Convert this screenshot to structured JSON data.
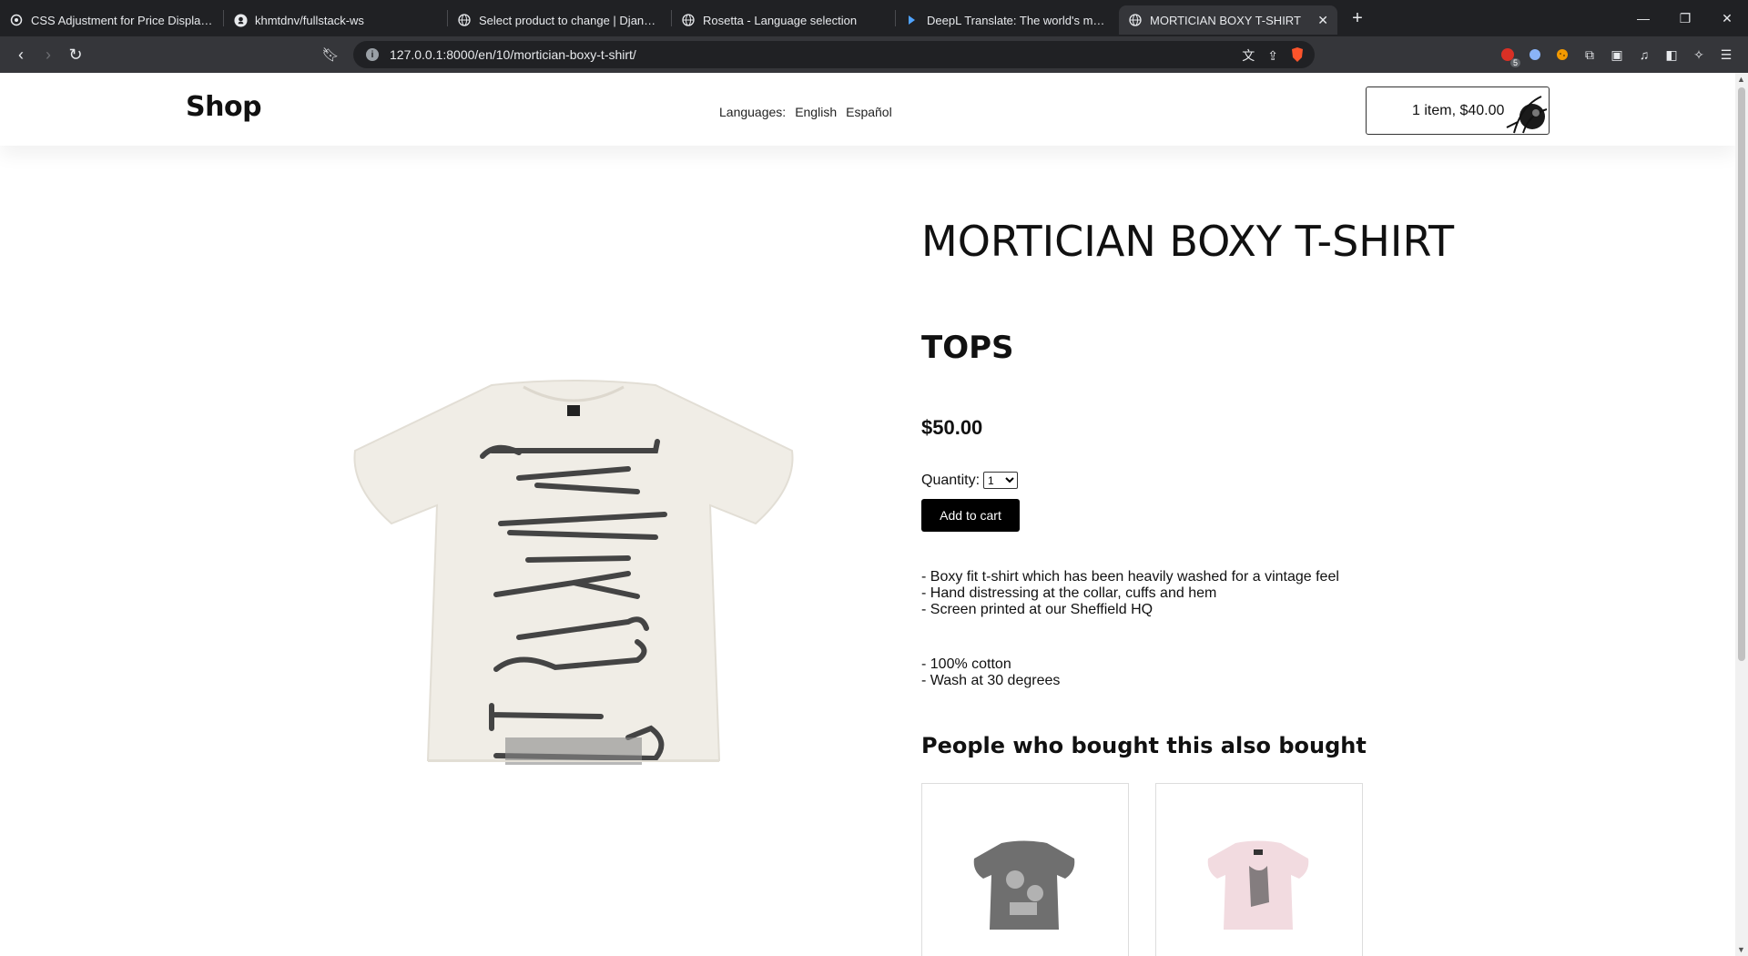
{
  "browser": {
    "tabs": [
      {
        "title": "CSS Adjustment for Price Display - G",
        "icon": "chatgpt-icon"
      },
      {
        "title": "khmtdnv/fullstack-ws",
        "icon": "github-icon"
      },
      {
        "title": "Select product to change | Django sit",
        "icon": "globe-icon"
      },
      {
        "title": "Rosetta - Language selection",
        "icon": "globe-icon"
      },
      {
        "title": "DeepL Translate: The world's most ac",
        "icon": "deepl-icon"
      },
      {
        "title": "MORTICIAN BOXY T-SHIRT",
        "icon": "globe-icon",
        "active": true
      }
    ],
    "url": "127.0.0.1:8000/en/10/mortician-boxy-t-shirt/",
    "extension_badge": "5"
  },
  "header": {
    "logo": "Shop",
    "languages_label": "Languages:",
    "languages": [
      "English",
      "Español"
    ],
    "cart_summary": "1 item, $40.00"
  },
  "product": {
    "title": "MORTICIAN BOXY T-SHIRT",
    "category": "TOPS",
    "price": "$50.00",
    "quantity_label": "Quantity:",
    "quantity_value": "1",
    "add_to_cart": "Add to cart",
    "description": [
      "- Boxy fit t-shirt which has been heavily washed for a vintage feel",
      "- Hand distressing at the collar, cuffs and hem",
      "- Screen printed at our Sheffield HQ"
    ],
    "details": [
      "- 100% cotton",
      "- Wash at 30 degrees"
    ]
  },
  "recommendations": {
    "heading": "People who bought this also bought",
    "items": [
      {
        "color": "#6f6f6f"
      },
      {
        "color": "#f2dbe0"
      }
    ]
  }
}
